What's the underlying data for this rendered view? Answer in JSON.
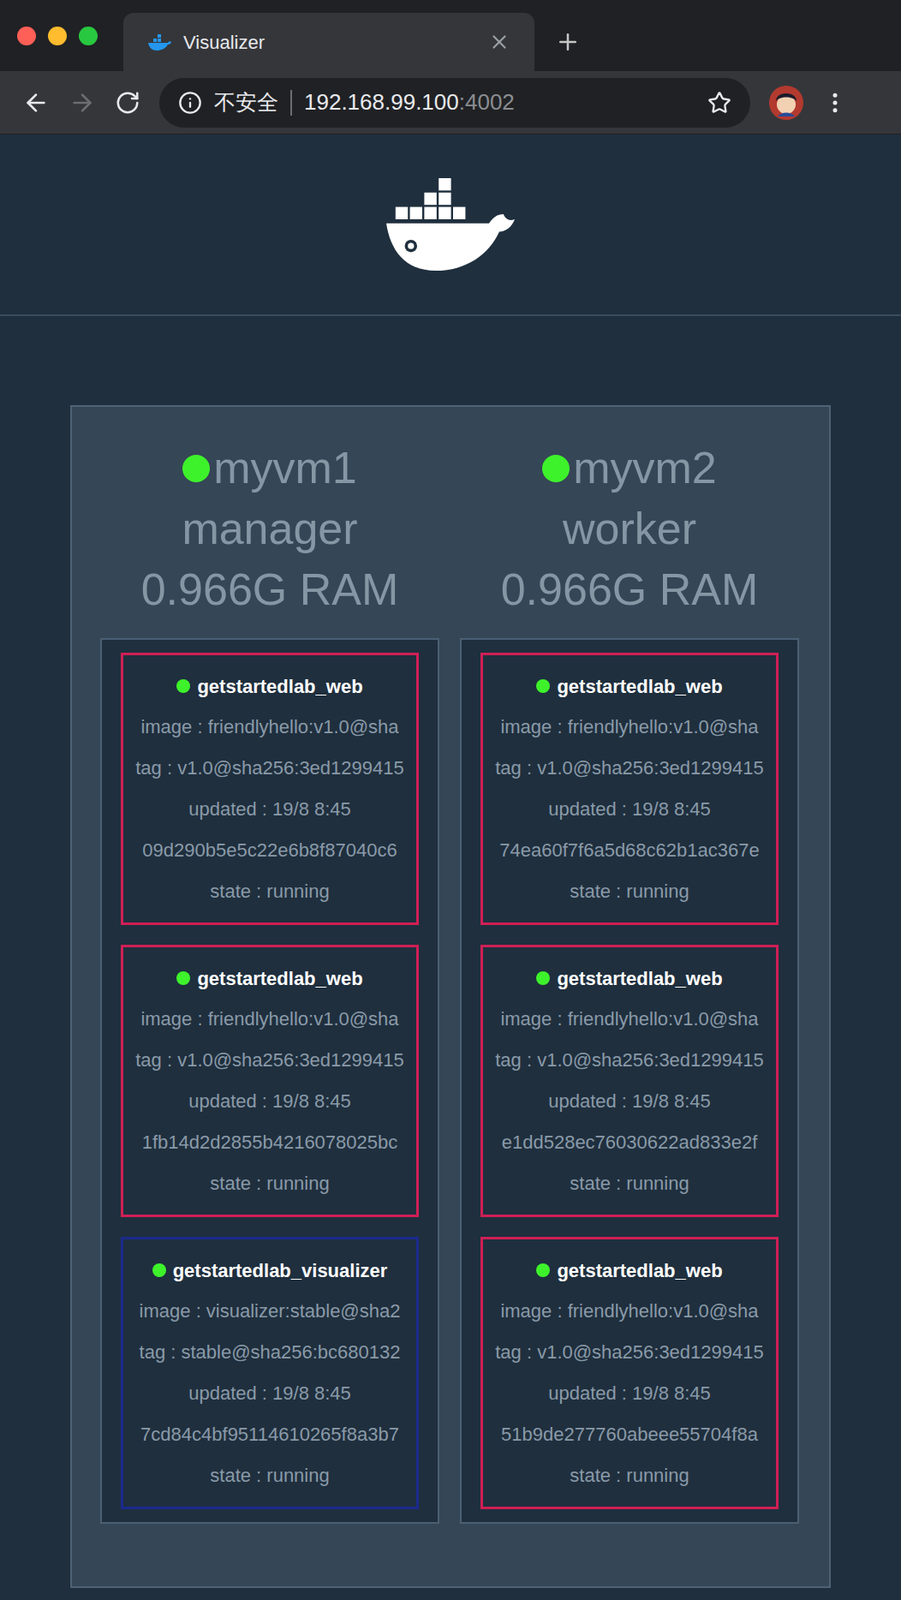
{
  "window": {
    "title": "Visualizer"
  },
  "address_bar": {
    "security": "不安全",
    "host": "192.168.99.100",
    "port": ":4002",
    "back_enabled": true,
    "forward_enabled": false
  },
  "nodes": [
    {
      "name": "myvm1",
      "role": "manager",
      "ram": "0.966G RAM",
      "containers": [
        {
          "name": "getstartedlab_web",
          "image": "image : friendlyhello:v1.0@sha",
          "tag": "tag : v1.0@sha256:3ed1299415",
          "updated": "updated : 19/8 8:45",
          "id": "09d290b5e5c22e6b8f87040c6",
          "state": "state : running",
          "color": "#d01f55"
        },
        {
          "name": "getstartedlab_web",
          "image": "image : friendlyhello:v1.0@sha",
          "tag": "tag : v1.0@sha256:3ed1299415",
          "updated": "updated : 19/8 8:45",
          "id": "1fb14d2d2855b4216078025bc",
          "state": "state : running",
          "color": "#d01f55"
        },
        {
          "name": "getstartedlab_visualizer",
          "image": "image : visualizer:stable@sha2",
          "tag": "tag : stable@sha256:bc680132",
          "updated": "updated : 19/8 8:45",
          "id": "7cd84c4bf95114610265f8a3b7",
          "state": "state : running",
          "color": "#1b2a8c"
        }
      ]
    },
    {
      "name": "myvm2",
      "role": "worker",
      "ram": "0.966G RAM",
      "containers": [
        {
          "name": "getstartedlab_web",
          "image": "image : friendlyhello:v1.0@sha",
          "tag": "tag : v1.0@sha256:3ed1299415",
          "updated": "updated : 19/8 8:45",
          "id": "74ea60f7f6a5d68c62b1ac367e",
          "state": "state : running",
          "color": "#d01f55"
        },
        {
          "name": "getstartedlab_web",
          "image": "image : friendlyhello:v1.0@sha",
          "tag": "tag : v1.0@sha256:3ed1299415",
          "updated": "updated : 19/8 8:45",
          "id": "e1dd528ec76030622ad833e2f",
          "state": "state : running",
          "color": "#d01f55"
        },
        {
          "name": "getstartedlab_web",
          "image": "image : friendlyhello:v1.0@sha",
          "tag": "tag : v1.0@sha256:3ed1299415",
          "updated": "updated : 19/8 8:45",
          "id": "51b9de277760abeee55704f8a",
          "state": "state : running",
          "color": "#d01f55"
        }
      ]
    }
  ]
}
